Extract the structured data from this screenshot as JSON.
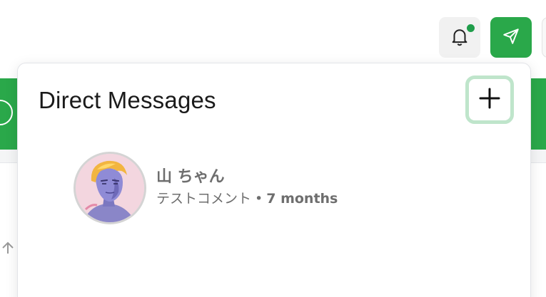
{
  "header": {
    "notifications_icon": "bell-icon",
    "notifications_dot_color": "#1f9d4a",
    "send_icon": "paper-plane-icon",
    "accent_color": "#2aa84a"
  },
  "popover": {
    "title": "Direct Messages",
    "add_icon": "plus-icon",
    "conversations": [
      {
        "name": "山 ちゃん",
        "last_message": "テストコメント",
        "separator": "•",
        "time_ago": "7 months",
        "avatar_icon": "user-avatar"
      }
    ]
  }
}
